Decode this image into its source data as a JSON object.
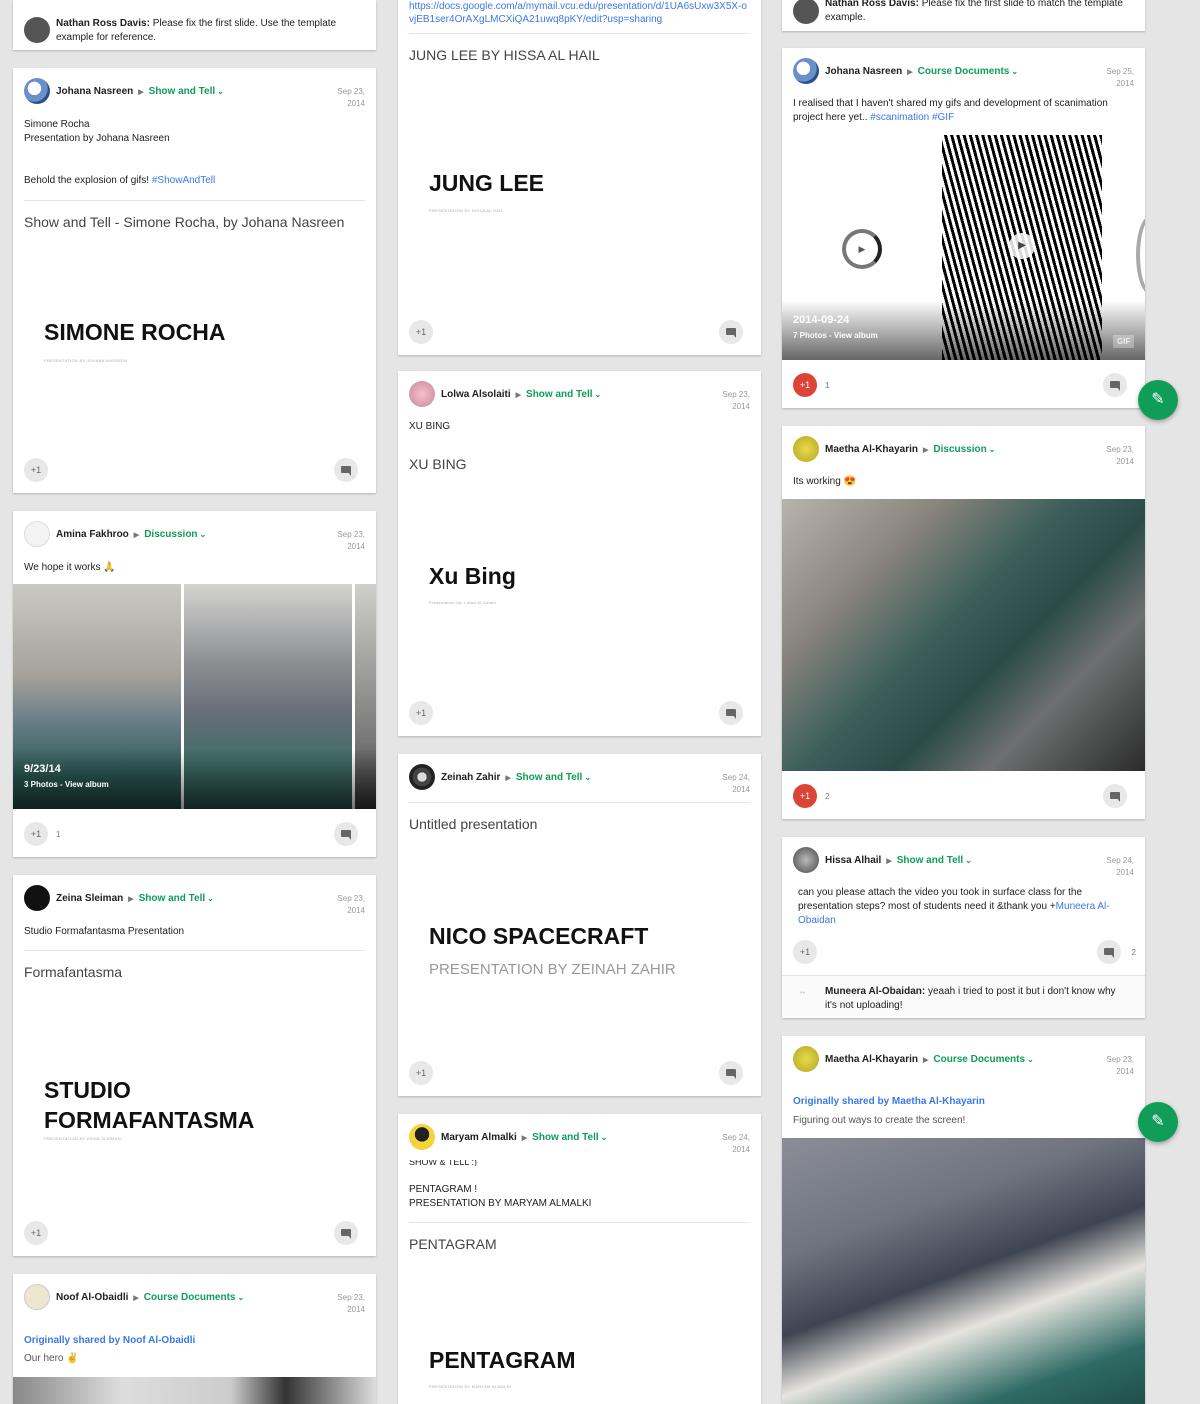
{
  "col1": {
    "comment_card": {
      "author": "Nathan Ross Davis:",
      "text": "Please fix the first slide. Use the template example for reference."
    },
    "post_simone": {
      "author": "Johana Nasreen",
      "category": "Show and Tell",
      "date_line1": "Sep 23,",
      "date_line2": "2014",
      "line1": "Simone Rocha",
      "line2": "Presentation by Johana Nasreen",
      "body": "Behold the explosion of gifs!",
      "hashtag": "#ShowAndTell",
      "slide_title": "Show and Tell - Simone Rocha, by Johana Nasreen",
      "slide_big": "SIMONE ROCHA",
      "slide_small": "PRESENTATION BY JOHANA NASREEN",
      "plus": "+1"
    },
    "post_amina": {
      "author": "Amina Fakhroo",
      "category": "Discussion",
      "date_line1": "Sep 23,",
      "date_line2": "2014",
      "body": "We hope it works",
      "album_date": "9/23/14",
      "album_caption": "3 Photos - View album",
      "plus": "+1",
      "plus_count": "1"
    },
    "post_zeina": {
      "author": "Zeina Sleiman",
      "category": "Show and Tell",
      "date_line1": "Sep 23,",
      "date_line2": "2014",
      "body": "Studio Formafantasma Presentation",
      "slide_title": "Formafantasma",
      "slide_big1": "STUDIO",
      "slide_big2": "FORMAFANTASMA",
      "slide_small": "PRESENTATION BY ZEINA SLEIMAN",
      "plus": "+1"
    },
    "post_noof": {
      "author": "Noof Al-Obaidli",
      "category": "Course Documents",
      "date_line1": "Sep 23,",
      "date_line2": "2014",
      "shared": "Originally shared by Noof Al-Obaidli",
      "body": "Our hero"
    }
  },
  "col2": {
    "post_jung": {
      "url": "https://docs.google.com/a/mymail.vcu.edu/presentation/d/1UA6sUxw3X5X-ovjEB1ser4OrAXgLMCXiQA21uwq8pKY/edit?usp=sharing",
      "slide_title": "JUNG LEE BY HISSA AL HAIL",
      "slide_big": "JUNG LEE",
      "slide_small": "PRESENTATION BY HISSA AL HAIL",
      "plus": "+1"
    },
    "post_xu": {
      "author": "Lolwa Alsolaiti",
      "category": "Show and Tell",
      "date_line1": "Sep 23,",
      "date_line2": "2014",
      "body": "XU BING",
      "slide_title": "XU BING",
      "slide_big": "Xu Bing",
      "slide_small": "Presentation by: Lolwa Al-Solaiti",
      "plus": "+1"
    },
    "post_nico": {
      "author": "Zeinah Zahir",
      "category": "Show and Tell",
      "date_line1": "Sep 24,",
      "date_line2": "2014",
      "slide_title": "Untitled presentation",
      "slide_big": "NICO SPACECRAFT",
      "slide_sub": "PRESENTATION BY ZEINAH ZAHIR",
      "plus": "+1"
    },
    "post_pentagram": {
      "author": "Maryam Almalki",
      "category": "Show and Tell",
      "date_line1": "Sep 24,",
      "date_line2": "2014",
      "cut_line": "SHOW & TELL :)",
      "line1": "PENTAGRAM !",
      "line2": "PRESENTATION BY MARYAM ALMALKI",
      "slide_title": "PENTAGRAM",
      "slide_big": "PENTAGRAM",
      "slide_small": "PRESENTATION BY MARYAM ALMALKI"
    }
  },
  "col3": {
    "comment_card": {
      "author": "Nathan Ross Davis:",
      "text": "Please fix the first slide to match the template example."
    },
    "post_gifs": {
      "author": "Johana Nasreen",
      "category": "Course Documents",
      "date_line1": "Sep 25,",
      "date_line2": "2014",
      "body": "I realised that I haven't shared my gifs and development of scanimation project here yet..",
      "hashtag1": "#scanimation",
      "hashtag2": "#GIF",
      "album_date": "2014-09-24",
      "album_caption": "7 Photos - View album",
      "gif_badge": "GIF",
      "plus": "+1",
      "plus_count": "1"
    },
    "post_maetha1": {
      "author": "Maetha Al-Khayarin",
      "category": "Discussion",
      "date_line1": "Sep 23,",
      "date_line2": "2014",
      "body": "Its working",
      "plus": "+1",
      "plus_count": "2"
    },
    "post_hissa": {
      "author": "Hissa Alhail",
      "category": "Show and Tell",
      "date_line1": "Sep 24,",
      "date_line2": "2014",
      "body": "can you please attach the video you took in surface class for the presentation steps? most of students need it &thank you +",
      "mention": "Muneera Al-Obaidan",
      "plus": "+1",
      "comment_count": "2",
      "reply_author": "Muneera Al-Obaidan:",
      "reply_text": "yeaah i tried to post it but i don't know why it's not uploading!"
    },
    "post_maetha2": {
      "author": "Maetha Al-Khayarin",
      "category": "Course Documents",
      "date_line1": "Sep 23,",
      "date_line2": "2014",
      "shared": "Originally shared by Maetha Al-Khayarin",
      "body": "Figuring out ways to create the screen!"
    }
  },
  "fab_icon": "pencil-icon",
  "colors": {
    "green": "#0f9d58",
    "red": "#db4437",
    "link": "#3b78e7"
  }
}
